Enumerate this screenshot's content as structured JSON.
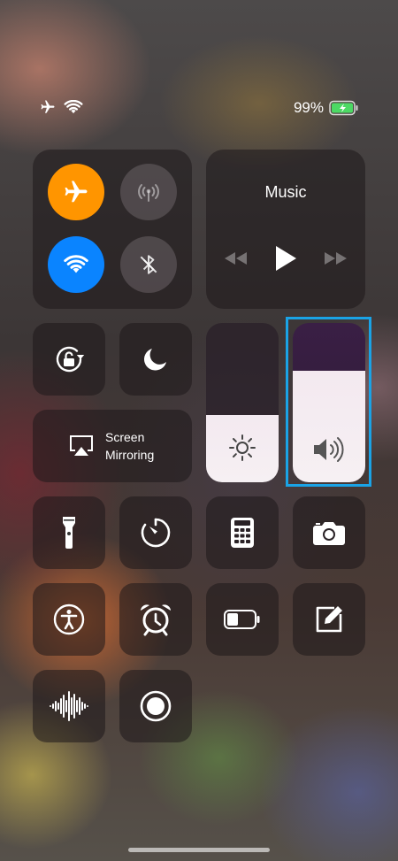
{
  "status_bar": {
    "battery_percent": "99%",
    "battery_level": 0.99,
    "icons": [
      "airplane-icon",
      "wifi-icon",
      "battery-charging-icon"
    ]
  },
  "connectivity": {
    "airplane_mode": true,
    "cellular": false,
    "wifi": true,
    "bluetooth": false
  },
  "music": {
    "title": "Music"
  },
  "screen_mirroring": {
    "label_line1": "Screen",
    "label_line2": "Mirroring"
  },
  "brightness": {
    "level": 0.42
  },
  "volume": {
    "level": 0.7
  },
  "colors": {
    "airplane_active": "#ff9500",
    "wifi_active": "#0a84ff",
    "highlight": "#1aa3e6"
  },
  "controls": [
    "rotation-lock-icon",
    "do-not-disturb-icon",
    "flashlight-icon",
    "timer-icon",
    "calculator-icon",
    "camera-icon",
    "accessibility-icon",
    "alarm-icon",
    "low-power-mode-icon",
    "notes-icon",
    "voice-memos-icon",
    "screen-recording-icon"
  ]
}
